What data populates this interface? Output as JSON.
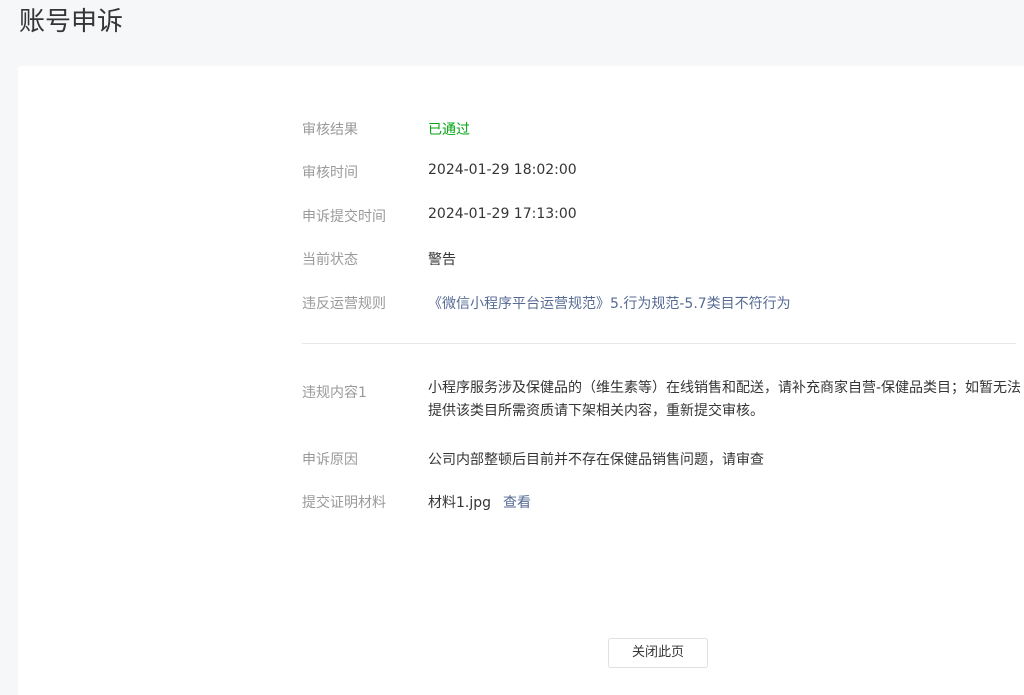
{
  "page": {
    "title": "账号申诉"
  },
  "details": {
    "review_result": {
      "label": "审核结果",
      "value": "已通过"
    },
    "review_time": {
      "label": "审核时间",
      "value": "2024-01-29 18:02:00"
    },
    "submit_time": {
      "label": "申诉提交时间",
      "value": "2024-01-29 17:13:00"
    },
    "current_status": {
      "label": "当前状态",
      "value": "警告"
    },
    "violated_rule": {
      "label": "违反运营规则",
      "value": "《微信小程序平台运营规范》5.行为规范-5.7类目不符行为"
    },
    "violation_content": {
      "label": "违规内容1",
      "value": "小程序服务涉及保健品的（维生素等）在线销售和配送，请补充商家自营-保健品类目；如暂无法提供该类目所需资质请下架相关内容，重新提交审核。"
    },
    "appeal_reason": {
      "label": "申诉原因",
      "value": "公司内部整顿后目前并不存在保健品销售问题，请审查"
    },
    "evidence": {
      "label": "提交证明材料",
      "file_name": "材料1.jpg",
      "view_link": "查看"
    }
  },
  "actions": {
    "close_label": "关闭此页"
  },
  "colors": {
    "success": "#07a614",
    "link": "#576b95",
    "label": "#9a9a9a",
    "text": "#353535"
  }
}
